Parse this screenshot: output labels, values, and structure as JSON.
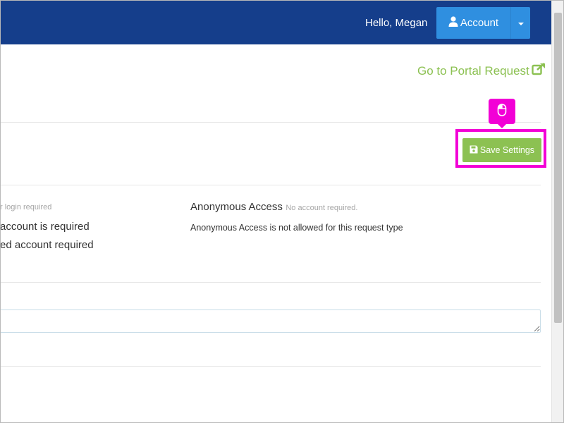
{
  "header": {
    "greeting": "Hello, Megan",
    "account_label": "Account"
  },
  "portal_link": {
    "label": "Go to Portal Request"
  },
  "save_button": {
    "label": "Save Settings"
  },
  "access": {
    "left_note": "r login required",
    "left_option_1": "account is required",
    "left_option_2": "ed account required",
    "anonymous_title": "Anonymous Access",
    "anonymous_note": "No account required.",
    "anonymous_desc": "Anonymous Access is not allowed for this request type"
  },
  "colors": {
    "navbar": "#153e8b",
    "account_button": "#2f8fe0",
    "accent_green": "#8cc152",
    "highlight_magenta": "#f200d6"
  },
  "icons": [
    "user-icon",
    "caret-down-icon",
    "external-link-icon",
    "mouse-icon",
    "save-icon"
  ]
}
